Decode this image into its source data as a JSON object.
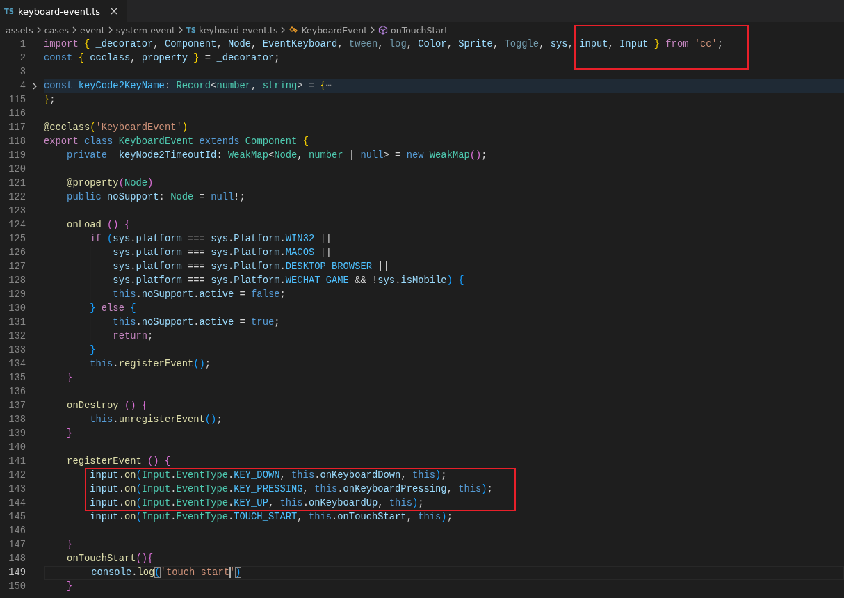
{
  "tab": {
    "icon_text": "TS",
    "title": "keyboard-event.ts",
    "selected": true
  },
  "breadcrumb": [
    {
      "label": "assets",
      "kind": "folder"
    },
    {
      "label": "cases",
      "kind": "folder"
    },
    {
      "label": "event",
      "kind": "folder"
    },
    {
      "label": "system-event",
      "kind": "folder"
    },
    {
      "label": "keyboard-event.ts",
      "kind": "file",
      "icon_text": "TS"
    },
    {
      "label": "KeyboardEvent",
      "kind": "class"
    },
    {
      "label": "onTouchStart",
      "kind": "method"
    }
  ],
  "lines": [
    {
      "number": "1",
      "folded": false,
      "current": false,
      "tokens": [
        {
          "kind": "ctl",
          "text": "import "
        },
        {
          "kind": "b1",
          "text": "{ "
        },
        {
          "kind": "var",
          "text": "_decorator"
        },
        {
          "kind": "p",
          "text": ", "
        },
        {
          "kind": "var",
          "text": "Component"
        },
        {
          "kind": "p",
          "text": ", "
        },
        {
          "kind": "var",
          "text": "Node"
        },
        {
          "kind": "p",
          "text": ", "
        },
        {
          "kind": "var",
          "text": "EventKeyboard"
        },
        {
          "kind": "p",
          "text": ", "
        },
        {
          "kind": "dim",
          "text": "tween"
        },
        {
          "kind": "p",
          "text": ", "
        },
        {
          "kind": "dim",
          "text": "log"
        },
        {
          "kind": "p",
          "text": ", "
        },
        {
          "kind": "var",
          "text": "Color"
        },
        {
          "kind": "p",
          "text": ", "
        },
        {
          "kind": "var",
          "text": "Sprite"
        },
        {
          "kind": "p",
          "text": ", "
        },
        {
          "kind": "dim",
          "text": "Toggle"
        },
        {
          "kind": "p",
          "text": ", "
        },
        {
          "kind": "var",
          "text": "sys"
        },
        {
          "kind": "p",
          "text": ", "
        },
        {
          "kind": "var",
          "text": "input"
        },
        {
          "kind": "p",
          "text": ", "
        },
        {
          "kind": "var",
          "text": "Input "
        },
        {
          "kind": "b1",
          "text": "} "
        },
        {
          "kind": "ctl",
          "text": "from "
        },
        {
          "kind": "str",
          "text": "'cc'"
        },
        {
          "kind": "p",
          "text": ";"
        }
      ]
    },
    {
      "number": "2",
      "folded": false,
      "current": false,
      "tokens": [
        {
          "kind": "kw",
          "text": "const "
        },
        {
          "kind": "b1",
          "text": "{ "
        },
        {
          "kind": "var",
          "text": "ccclass"
        },
        {
          "kind": "p",
          "text": ", "
        },
        {
          "kind": "var",
          "text": "property "
        },
        {
          "kind": "b1",
          "text": "}"
        },
        {
          "kind": "p",
          "text": " = "
        },
        {
          "kind": "var",
          "text": "_decorator"
        },
        {
          "kind": "p",
          "text": ";"
        }
      ]
    },
    {
      "number": "3"
    },
    {
      "number": "4",
      "folded": true,
      "current": false,
      "tokens": [
        {
          "kind": "kw",
          "text": "const "
        },
        {
          "kind": "cst",
          "text": "keyCode2KeyName"
        },
        {
          "kind": "p",
          "text": ": "
        },
        {
          "kind": "type",
          "text": "Record"
        },
        {
          "kind": "p",
          "text": "<"
        },
        {
          "kind": "type",
          "text": "number"
        },
        {
          "kind": "p",
          "text": ", "
        },
        {
          "kind": "type",
          "text": "string"
        },
        {
          "kind": "p",
          "text": "> = "
        },
        {
          "kind": "b1",
          "text": "{"
        },
        {
          "kind": "fold",
          "text": "⋯"
        }
      ]
    },
    {
      "number": "115",
      "folded": false,
      "current": false,
      "tokens": [
        {
          "kind": "b1",
          "text": "}"
        },
        {
          "kind": "p",
          "text": ";"
        }
      ]
    },
    {
      "number": "116"
    },
    {
      "number": "117",
      "folded": false,
      "current": false,
      "tokens": [
        {
          "kind": "fn",
          "text": "@ccclass"
        },
        {
          "kind": "b1",
          "text": "("
        },
        {
          "kind": "str",
          "text": "'KeyboardEvent'"
        },
        {
          "kind": "b1",
          "text": ")"
        }
      ]
    },
    {
      "number": "118",
      "folded": false,
      "current": false,
      "tokens": [
        {
          "kind": "ctl",
          "text": "export "
        },
        {
          "kind": "kw",
          "text": "class "
        },
        {
          "kind": "type",
          "text": "KeyboardEvent "
        },
        {
          "kind": "kw",
          "text": "extends "
        },
        {
          "kind": "type",
          "text": "Component "
        },
        {
          "kind": "b1",
          "text": "{"
        }
      ]
    },
    {
      "number": "119",
      "folded": false,
      "current": false,
      "tokens": [
        {
          "kind": "kw",
          "text": "    private "
        },
        {
          "kind": "var",
          "text": "_keyNode2TimeoutId"
        },
        {
          "kind": "p",
          "text": ": "
        },
        {
          "kind": "type",
          "text": "WeakMap"
        },
        {
          "kind": "p",
          "text": "<"
        },
        {
          "kind": "type",
          "text": "Node"
        },
        {
          "kind": "p",
          "text": ", "
        },
        {
          "kind": "type",
          "text": "number"
        },
        {
          "kind": "p",
          "text": " | "
        },
        {
          "kind": "kw",
          "text": "null"
        },
        {
          "kind": "p",
          "text": "> = "
        },
        {
          "kind": "kw",
          "text": "new "
        },
        {
          "kind": "type",
          "text": "WeakMap"
        },
        {
          "kind": "b2",
          "text": "()"
        },
        {
          "kind": "p",
          "text": ";"
        }
      ]
    },
    {
      "number": "120"
    },
    {
      "number": "121",
      "folded": false,
      "current": false,
      "tokens": [
        {
          "kind": "fn",
          "text": "    @property"
        },
        {
          "kind": "b2",
          "text": "("
        },
        {
          "kind": "type",
          "text": "Node"
        },
        {
          "kind": "b2",
          "text": ")"
        }
      ]
    },
    {
      "number": "122",
      "folded": false,
      "current": false,
      "tokens": [
        {
          "kind": "kw",
          "text": "    public "
        },
        {
          "kind": "var",
          "text": "noSupport"
        },
        {
          "kind": "p",
          "text": ": "
        },
        {
          "kind": "type",
          "text": "Node"
        },
        {
          "kind": "p",
          "text": " = "
        },
        {
          "kind": "kw",
          "text": "null"
        },
        {
          "kind": "p",
          "text": "!;"
        }
      ]
    },
    {
      "number": "123"
    },
    {
      "number": "124",
      "folded": false,
      "current": false,
      "tokens": [
        {
          "kind": "fn",
          "text": "    onLoad "
        },
        {
          "kind": "b2",
          "text": "() {"
        }
      ]
    },
    {
      "number": "125",
      "folded": false,
      "current": false,
      "tokens": [
        {
          "kind": "ctl",
          "text": "        if "
        },
        {
          "kind": "b3",
          "text": "("
        },
        {
          "kind": "var",
          "text": "sys"
        },
        {
          "kind": "p",
          "text": "."
        },
        {
          "kind": "var",
          "text": "platform"
        },
        {
          "kind": "p",
          "text": " === "
        },
        {
          "kind": "var",
          "text": "sys"
        },
        {
          "kind": "p",
          "text": "."
        },
        {
          "kind": "var",
          "text": "Platform"
        },
        {
          "kind": "p",
          "text": "."
        },
        {
          "kind": "cst",
          "text": "WIN32"
        },
        {
          "kind": "p",
          "text": " ||"
        }
      ]
    },
    {
      "number": "126",
      "folded": false,
      "current": false,
      "tokens": [
        {
          "kind": "var",
          "text": "            sys"
        },
        {
          "kind": "p",
          "text": "."
        },
        {
          "kind": "var",
          "text": "platform"
        },
        {
          "kind": "p",
          "text": " === "
        },
        {
          "kind": "var",
          "text": "sys"
        },
        {
          "kind": "p",
          "text": "."
        },
        {
          "kind": "var",
          "text": "Platform"
        },
        {
          "kind": "p",
          "text": "."
        },
        {
          "kind": "cst",
          "text": "MACOS"
        },
        {
          "kind": "p",
          "text": " ||"
        }
      ]
    },
    {
      "number": "127",
      "folded": false,
      "current": false,
      "tokens": [
        {
          "kind": "var",
          "text": "            sys"
        },
        {
          "kind": "p",
          "text": "."
        },
        {
          "kind": "var",
          "text": "platform"
        },
        {
          "kind": "p",
          "text": " === "
        },
        {
          "kind": "var",
          "text": "sys"
        },
        {
          "kind": "p",
          "text": "."
        },
        {
          "kind": "var",
          "text": "Platform"
        },
        {
          "kind": "p",
          "text": "."
        },
        {
          "kind": "cst",
          "text": "DESKTOP_BROWSER"
        },
        {
          "kind": "p",
          "text": " ||"
        }
      ]
    },
    {
      "number": "128",
      "folded": false,
      "current": false,
      "tokens": [
        {
          "kind": "var",
          "text": "            sys"
        },
        {
          "kind": "p",
          "text": "."
        },
        {
          "kind": "var",
          "text": "platform"
        },
        {
          "kind": "p",
          "text": " === "
        },
        {
          "kind": "var",
          "text": "sys"
        },
        {
          "kind": "p",
          "text": "."
        },
        {
          "kind": "var",
          "text": "Platform"
        },
        {
          "kind": "p",
          "text": "."
        },
        {
          "kind": "cst",
          "text": "WECHAT_GAME"
        },
        {
          "kind": "p",
          "text": " && !"
        },
        {
          "kind": "var",
          "text": "sys"
        },
        {
          "kind": "p",
          "text": "."
        },
        {
          "kind": "var",
          "text": "isMobile"
        },
        {
          "kind": "b3",
          "text": ") {"
        }
      ]
    },
    {
      "number": "129",
      "folded": false,
      "current": false,
      "tokens": [
        {
          "kind": "kw",
          "text": "            this"
        },
        {
          "kind": "p",
          "text": "."
        },
        {
          "kind": "var",
          "text": "noSupport"
        },
        {
          "kind": "p",
          "text": "."
        },
        {
          "kind": "var",
          "text": "active"
        },
        {
          "kind": "p",
          "text": " = "
        },
        {
          "kind": "kw",
          "text": "false"
        },
        {
          "kind": "p",
          "text": ";"
        }
      ]
    },
    {
      "number": "130",
      "folded": false,
      "current": false,
      "tokens": [
        {
          "kind": "b3",
          "text": "        } "
        },
        {
          "kind": "ctl",
          "text": "else "
        },
        {
          "kind": "b3",
          "text": "{"
        }
      ]
    },
    {
      "number": "131",
      "folded": false,
      "current": false,
      "tokens": [
        {
          "kind": "kw",
          "text": "            this"
        },
        {
          "kind": "p",
          "text": "."
        },
        {
          "kind": "var",
          "text": "noSupport"
        },
        {
          "kind": "p",
          "text": "."
        },
        {
          "kind": "var",
          "text": "active"
        },
        {
          "kind": "p",
          "text": " = "
        },
        {
          "kind": "kw",
          "text": "true"
        },
        {
          "kind": "p",
          "text": ";"
        }
      ]
    },
    {
      "number": "132",
      "folded": false,
      "current": false,
      "tokens": [
        {
          "kind": "ctl",
          "text": "            return"
        },
        {
          "kind": "p",
          "text": ";"
        }
      ]
    },
    {
      "number": "133",
      "folded": false,
      "current": false,
      "tokens": [
        {
          "kind": "b3",
          "text": "        }"
        }
      ]
    },
    {
      "number": "134",
      "folded": false,
      "current": false,
      "tokens": [
        {
          "kind": "kw",
          "text": "        this"
        },
        {
          "kind": "p",
          "text": "."
        },
        {
          "kind": "fn",
          "text": "registerEvent"
        },
        {
          "kind": "b3",
          "text": "()"
        },
        {
          "kind": "p",
          "text": ";"
        }
      ]
    },
    {
      "number": "135",
      "folded": false,
      "current": false,
      "tokens": [
        {
          "kind": "b2",
          "text": "    }"
        }
      ]
    },
    {
      "number": "136"
    },
    {
      "number": "137",
      "folded": false,
      "current": false,
      "tokens": [
        {
          "kind": "fn",
          "text": "    onDestroy "
        },
        {
          "kind": "b2",
          "text": "() {"
        }
      ]
    },
    {
      "number": "138",
      "folded": false,
      "current": false,
      "tokens": [
        {
          "kind": "kw",
          "text": "        this"
        },
        {
          "kind": "p",
          "text": "."
        },
        {
          "kind": "fn",
          "text": "unregisterEvent"
        },
        {
          "kind": "b3",
          "text": "()"
        },
        {
          "kind": "p",
          "text": ";"
        }
      ]
    },
    {
      "number": "139",
      "folded": false,
      "current": false,
      "tokens": [
        {
          "kind": "b2",
          "text": "    }"
        }
      ]
    },
    {
      "number": "140"
    },
    {
      "number": "141",
      "folded": false,
      "current": false,
      "tokens": [
        {
          "kind": "fn",
          "text": "    registerEvent "
        },
        {
          "kind": "b2",
          "text": "() {"
        }
      ]
    },
    {
      "number": "142",
      "folded": false,
      "current": false,
      "tokens": [
        {
          "kind": "var",
          "text": "        input"
        },
        {
          "kind": "p",
          "text": "."
        },
        {
          "kind": "fn",
          "text": "on"
        },
        {
          "kind": "b3",
          "text": "("
        },
        {
          "kind": "type",
          "text": "Input"
        },
        {
          "kind": "p",
          "text": "."
        },
        {
          "kind": "type",
          "text": "EventType"
        },
        {
          "kind": "p",
          "text": "."
        },
        {
          "kind": "cst",
          "text": "KEY_DOWN"
        },
        {
          "kind": "p",
          "text": ", "
        },
        {
          "kind": "kw",
          "text": "this"
        },
        {
          "kind": "p",
          "text": "."
        },
        {
          "kind": "var",
          "text": "onKeyboardDown"
        },
        {
          "kind": "p",
          "text": ", "
        },
        {
          "kind": "kw",
          "text": "this"
        },
        {
          "kind": "b3",
          "text": ")"
        },
        {
          "kind": "p",
          "text": ";"
        }
      ]
    },
    {
      "number": "143",
      "folded": false,
      "current": false,
      "tokens": [
        {
          "kind": "var",
          "text": "        input"
        },
        {
          "kind": "p",
          "text": "."
        },
        {
          "kind": "fn",
          "text": "on"
        },
        {
          "kind": "b3",
          "text": "("
        },
        {
          "kind": "type",
          "text": "Input"
        },
        {
          "kind": "p",
          "text": "."
        },
        {
          "kind": "type",
          "text": "EventType"
        },
        {
          "kind": "p",
          "text": "."
        },
        {
          "kind": "cst",
          "text": "KEY_PRESSING"
        },
        {
          "kind": "p",
          "text": ", "
        },
        {
          "kind": "kw",
          "text": "this"
        },
        {
          "kind": "p",
          "text": "."
        },
        {
          "kind": "var",
          "text": "onKeyboardPressing"
        },
        {
          "kind": "p",
          "text": ", "
        },
        {
          "kind": "kw",
          "text": "this"
        },
        {
          "kind": "b3",
          "text": ")"
        },
        {
          "kind": "p",
          "text": ";"
        }
      ]
    },
    {
      "number": "144",
      "folded": false,
      "current": false,
      "tokens": [
        {
          "kind": "var",
          "text": "        input"
        },
        {
          "kind": "p",
          "text": "."
        },
        {
          "kind": "fn",
          "text": "on"
        },
        {
          "kind": "b3",
          "text": "("
        },
        {
          "kind": "type",
          "text": "Input"
        },
        {
          "kind": "p",
          "text": "."
        },
        {
          "kind": "type",
          "text": "EventType"
        },
        {
          "kind": "p",
          "text": "."
        },
        {
          "kind": "cst",
          "text": "KEY_UP"
        },
        {
          "kind": "p",
          "text": ", "
        },
        {
          "kind": "kw",
          "text": "this"
        },
        {
          "kind": "p",
          "text": "."
        },
        {
          "kind": "var",
          "text": "onKeyboardUp"
        },
        {
          "kind": "p",
          "text": ", "
        },
        {
          "kind": "kw",
          "text": "this"
        },
        {
          "kind": "b3",
          "text": ")"
        },
        {
          "kind": "p",
          "text": ";"
        }
      ]
    },
    {
      "number": "145",
      "folded": false,
      "current": false,
      "tokens": [
        {
          "kind": "var",
          "text": "        input"
        },
        {
          "kind": "p",
          "text": "."
        },
        {
          "kind": "fn",
          "text": "on"
        },
        {
          "kind": "b3",
          "text": "("
        },
        {
          "kind": "type",
          "text": "Input"
        },
        {
          "kind": "p",
          "text": "."
        },
        {
          "kind": "type",
          "text": "EventType"
        },
        {
          "kind": "p",
          "text": "."
        },
        {
          "kind": "cst",
          "text": "TOUCH_START"
        },
        {
          "kind": "p",
          "text": ", "
        },
        {
          "kind": "kw",
          "text": "this"
        },
        {
          "kind": "p",
          "text": "."
        },
        {
          "kind": "var",
          "text": "onTouchStart"
        },
        {
          "kind": "p",
          "text": ", "
        },
        {
          "kind": "kw",
          "text": "this"
        },
        {
          "kind": "b3",
          "text": ")"
        },
        {
          "kind": "p",
          "text": ";"
        }
      ]
    },
    {
      "number": "146"
    },
    {
      "number": "147",
      "folded": false,
      "current": false,
      "tokens": [
        {
          "kind": "b2",
          "text": "    }"
        }
      ]
    },
    {
      "number": "148",
      "folded": false,
      "current": false,
      "tokens": [
        {
          "kind": "fn",
          "text": "    onTouchStart"
        },
        {
          "kind": "b2",
          "text": "(){"
        }
      ]
    },
    {
      "number": "149",
      "folded": false,
      "current": true,
      "tokens": [
        {
          "kind": "var",
          "text": "        console"
        },
        {
          "kind": "p",
          "text": "."
        },
        {
          "kind": "fn",
          "text": "log"
        },
        {
          "kind": "b3",
          "text": "(",
          "matched": true,
          "caret_after": false
        },
        {
          "kind": "str",
          "text": "'touch start",
          "matched": false,
          "caret_after": true
        },
        {
          "kind": "str",
          "text": "'",
          "matched": false,
          "caret_after": false
        },
        {
          "kind": "b3",
          "text": ")",
          "matched": true,
          "caret_after": false
        }
      ]
    },
    {
      "number": "150",
      "folded": false,
      "current": false,
      "tokens": [
        {
          "kind": "b2",
          "text": "    }"
        }
      ]
    }
  ]
}
